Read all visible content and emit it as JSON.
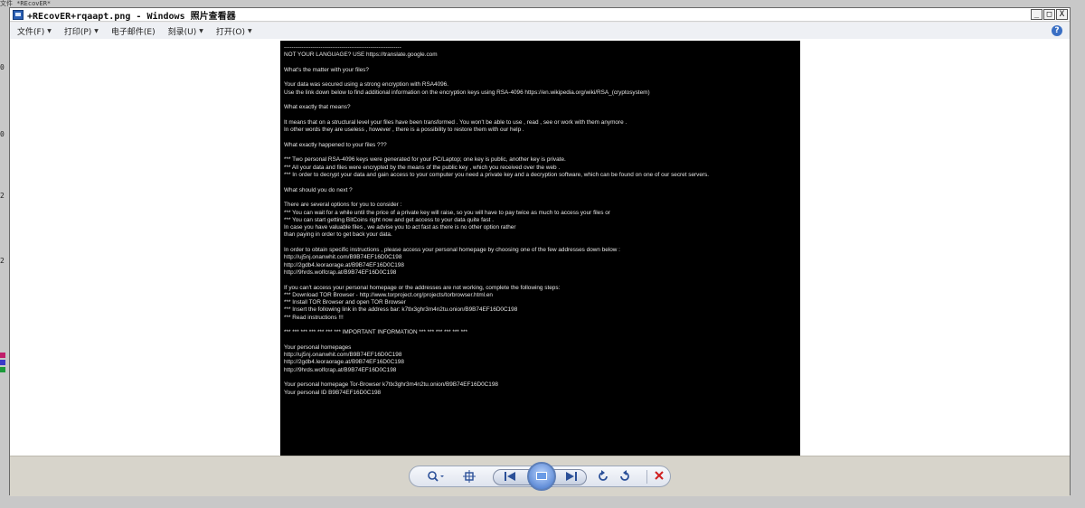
{
  "desktop": {
    "corner_label": "文件 *REcovER*"
  },
  "window": {
    "title": "+REcovER+rqaapt.png - Windows 照片查看器",
    "controls": {
      "minimize": "_",
      "maximize": "□",
      "close": "X"
    }
  },
  "menu": {
    "items": [
      {
        "label": "文件(F)"
      },
      {
        "label": "打印(P)"
      },
      {
        "label": "电子邮件(E)"
      },
      {
        "label": "刻录(U)"
      },
      {
        "label": "打开(O)"
      }
    ],
    "help_label": "?"
  },
  "image_text": {
    "lines": [
      "-------------------------------------------------------------",
      "NOT YOUR LANGUAGE? USE https://translate.google.com",
      "",
      "What's the matter with your files?",
      "",
      "Your data was secured using a strong encryption with RSA4096.",
      "Use the link down below to find additional information on the encryption keys using RSA-4096 https://en.wikipedia.org/wiki/RSA_(cryptosystem)",
      "",
      "What exactly that means?",
      "",
      "It means that on a structural level your files have been transformed . You won't be able to use , read , see or work with them anymore .",
      "In other words they are useless , however , there is a possibility to restore them with our help .",
      "",
      "What exactly happened to your files ???",
      "",
      "*** Two personal RSA-4096 keys were generated for your PC/Laptop; one key is public, another key is private.",
      "*** All your data and files were encrypted by the means of the public key , which you received over the web .",
      "*** In order to decrypt your data and gain access to your computer you need a private key and a decryption software, which can be found on one of our secret servers.",
      "",
      "What should you do next ?",
      "",
      "There are several options for you to consider :",
      "***  You can wait for a while until the price of a private key will raise, so you will have to pay twice as much to access your files or",
      "***  You can start getting BitCoins right now and get access to your data quite fast .",
      "In case you have valuable files , we advise you to act fast as there is no other option rather",
      "than paying in order to get back your data.",
      "",
      "In order to obtain specific instructions , please access your personal homepage by choosing one of the few addresses down below :",
      "http://uj5nj.onanwhit.com/B9B74EF16D0C198",
      "http://2gdb4.leoraorage.at/B9B74EF16D0C198",
      "http://9hrds.wolfcrap.at/B9B74EF16D0C198",
      "",
      "If you can't access your personal homepage or the addresses are not working, complete the following steps:",
      "*** Download TOR Browser - http://www.torproject.org/projects/torbrowser.html.en",
      "*** Install TOR Browser and open TOR Browser",
      "*** Insert the following link in the address bar: k7tlx3ghr3m4n2tu.onion/B9B74EF16D0C198",
      "*** Read instructions !!!",
      "",
      "*** *** *** *** *** *** *** IMPORTANT INFORMATION *** *** *** *** *** ***",
      "",
      "Your personal homepages",
      "http://uj5nj.onanwhit.com/B9B74EF16D0C198",
      "http://2gdb4.leoraorage.at/B9B74EF16D0C198",
      "http://9hrds.wolfcrap.at/B9B74EF16D0C198",
      "",
      "Your personal homepage Tor-Browser k7tlx3ghr3m4n2tu.onion/B9B74EF16D0C198",
      "Your personal ID B9B74EF16D0C198"
    ]
  },
  "toolbar": {
    "zoom_icon": "zoom-icon",
    "actual_size_icon": "actual-size-icon",
    "prev_icon": "previous-icon",
    "slideshow_icon": "slideshow-icon",
    "next_icon": "next-icon",
    "rotate_ccw_icon": "rotate-counterclockwise-icon",
    "rotate_cw_icon": "rotate-clockwise-icon",
    "delete_icon": "delete-icon",
    "colors": {
      "accent": "#2a4f98",
      "delete": "#d02020"
    }
  }
}
